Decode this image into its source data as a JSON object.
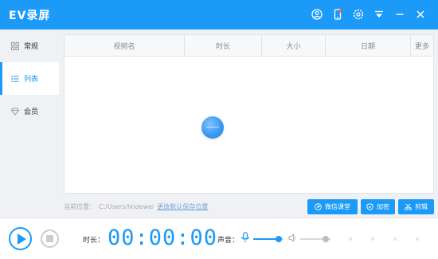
{
  "app": {
    "title": "EV录屏",
    "brand_color": "#1b9af7"
  },
  "titlebar": {
    "icons": [
      "user-icon",
      "phone-icon",
      "settings-icon",
      "dropdown-menu-icon",
      "minimize-icon",
      "close-icon"
    ]
  },
  "sidebar": {
    "items": [
      {
        "label": "常规",
        "icon": "grid-icon",
        "active": false
      },
      {
        "label": "列表",
        "icon": "list-icon",
        "active": true
      },
      {
        "label": "会员",
        "icon": "diamond-icon",
        "active": false
      }
    ]
  },
  "table": {
    "columns": [
      "视频名",
      "时长",
      "大小",
      "日期",
      "更多"
    ],
    "rows": []
  },
  "path": {
    "label": "当前位置：",
    "value": "C:/Users/lindewei",
    "change_link": "更改默认保存位置"
  },
  "actions": {
    "wechat": "微信课堂",
    "encrypt": "加密",
    "edit": "剪辑"
  },
  "bottom": {
    "duration_label": "时长：",
    "timer": "00:00:00",
    "volume_label": "声音：",
    "mic_level": 0.85,
    "speaker_level": 0.85
  }
}
